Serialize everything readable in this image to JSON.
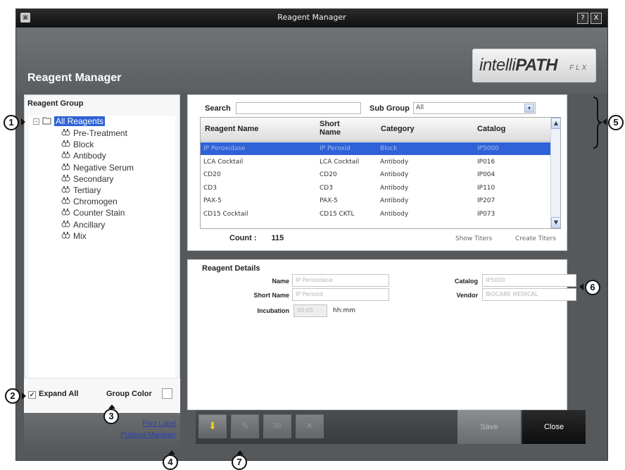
{
  "window": {
    "title": "Reagent Manager",
    "help_label": "?",
    "close_label": "X",
    "app_icon": "app-icon"
  },
  "header": {
    "title": "Reagent Manager",
    "logo_main_light": "intelli",
    "logo_main_bold": "PATH",
    "logo_suffix": "FLX"
  },
  "reagent_group": {
    "heading": "Reagent Group",
    "root": {
      "label": "All Reagents",
      "expander": "⊟",
      "selected": true
    },
    "items": [
      {
        "label": "Pre-Treatment"
      },
      {
        "label": "Block"
      },
      {
        "label": "Antibody"
      },
      {
        "label": "Negative Serum"
      },
      {
        "label": "Secondary"
      },
      {
        "label": "Tertiary"
      },
      {
        "label": "Chromogen"
      },
      {
        "label": "Counter Stain"
      },
      {
        "label": "Ancillary"
      },
      {
        "label": "Mix"
      }
    ],
    "expand_all_label": "Expand All",
    "expand_all_checked": true,
    "group_color_label": "Group Color",
    "print_label_link": "Print Label",
    "protocol_manager_link": "Protocol Manager"
  },
  "search": {
    "label": "Search",
    "value": "",
    "subgroup_label": "Sub Group",
    "subgroup_value": "All"
  },
  "table": {
    "columns": [
      "Reagent Name",
      "Short\nName",
      "Category",
      "Catalog"
    ],
    "column_short_line1": "Short",
    "column_short_line2": "Name",
    "rows": [
      {
        "name": "IP Peroxidase",
        "short": "IP Peroxid",
        "category": "Block",
        "catalog": "IP5000",
        "selected": true
      },
      {
        "name": "LCA Cocktail",
        "short": "LCA Cocktail",
        "category": "Antibody",
        "catalog": "IP016"
      },
      {
        "name": "CD20",
        "short": "CD20",
        "category": "Antibody",
        "catalog": "IP004"
      },
      {
        "name": "CD3",
        "short": "CD3",
        "category": "Antibody",
        "catalog": "IP110"
      },
      {
        "name": "PAX-5",
        "short": "PAX-5",
        "category": "Antibody",
        "catalog": "IP207"
      },
      {
        "name": "CD15 Cocktail",
        "short": "CD15 CKTL",
        "category": "Antibody",
        "catalog": "IP073"
      }
    ],
    "count_label": "Count :",
    "count_value": "115",
    "show_titers": "Show Titers",
    "create_titers": "Create Titers"
  },
  "details": {
    "heading": "Reagent Details",
    "name_label": "Name",
    "name_value": "IP Peroxidase",
    "short_name_label": "Short Name",
    "short_name_value": "IP Peroxid",
    "incubation_label": "Incubation",
    "incubation_value": "00:05",
    "incubation_unit": "hh:mm",
    "catalog_label": "Catalog",
    "catalog_value": "IP5000",
    "vendor_label": "Vendor",
    "vendor_value": "BIOCARE MEDICAL"
  },
  "toolbar": {
    "buttons": [
      {
        "icon": "import-arrow-icon",
        "glyph": "⬇"
      },
      {
        "icon": "edit-icon",
        "glyph": "✎"
      },
      {
        "icon": "email-icon",
        "glyph": "✉"
      },
      {
        "icon": "delete-icon",
        "glyph": "✕"
      }
    ],
    "save_label": "Save",
    "close_label": "Close"
  },
  "callouts": [
    "1",
    "2",
    "3",
    "4",
    "5",
    "6",
    "7"
  ],
  "colors": {
    "selection": "#2e62d6",
    "chrome": "#56595c",
    "link": "#2a3fb0"
  }
}
